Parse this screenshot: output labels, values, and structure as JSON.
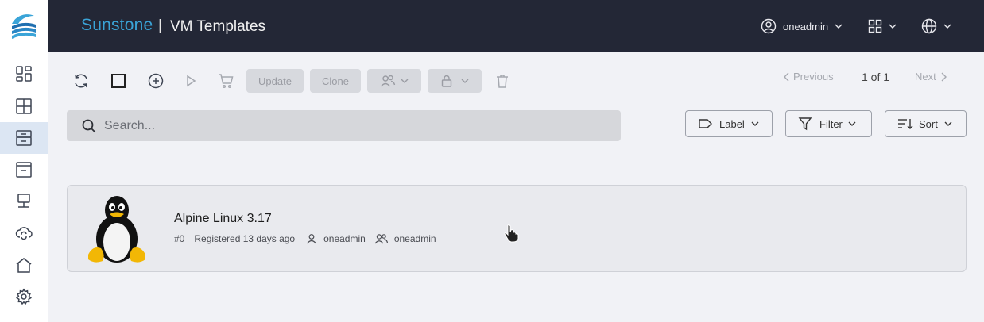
{
  "header": {
    "brand": "Sunstone",
    "separator": "|",
    "title": "VM Templates",
    "user": "oneadmin"
  },
  "sidebar": {
    "items": [
      {
        "name": "dashboard",
        "icon": "dashboard-icon"
      },
      {
        "name": "instances",
        "icon": "grid-icon"
      },
      {
        "name": "templates",
        "icon": "archive-icon",
        "active": true
      },
      {
        "name": "storage",
        "icon": "box-icon"
      },
      {
        "name": "networks",
        "icon": "monitor-icon"
      },
      {
        "name": "cloud",
        "icon": "cloud-sync-icon"
      },
      {
        "name": "infrastructure",
        "icon": "home-icon"
      },
      {
        "name": "settings",
        "icon": "gear-icon"
      }
    ]
  },
  "toolbar": {
    "update_label": "Update",
    "clone_label": "Clone"
  },
  "pagination": {
    "previous_label": "Previous",
    "page_info": "1 of 1",
    "next_label": "Next"
  },
  "search": {
    "placeholder": "Search..."
  },
  "controls": {
    "label_label": "Label",
    "filter_label": "Filter",
    "sort_label": "Sort"
  },
  "templates": [
    {
      "name": "Alpine Linux 3.17",
      "id": "#0",
      "registered": "Registered 13 days ago",
      "owner": "oneadmin",
      "group": "oneadmin",
      "logo": "tux-penguin-logo"
    }
  ],
  "colors": {
    "header_bg": "#232736",
    "brand": "#3aa4d8",
    "active_nav": "#dce6f3"
  }
}
